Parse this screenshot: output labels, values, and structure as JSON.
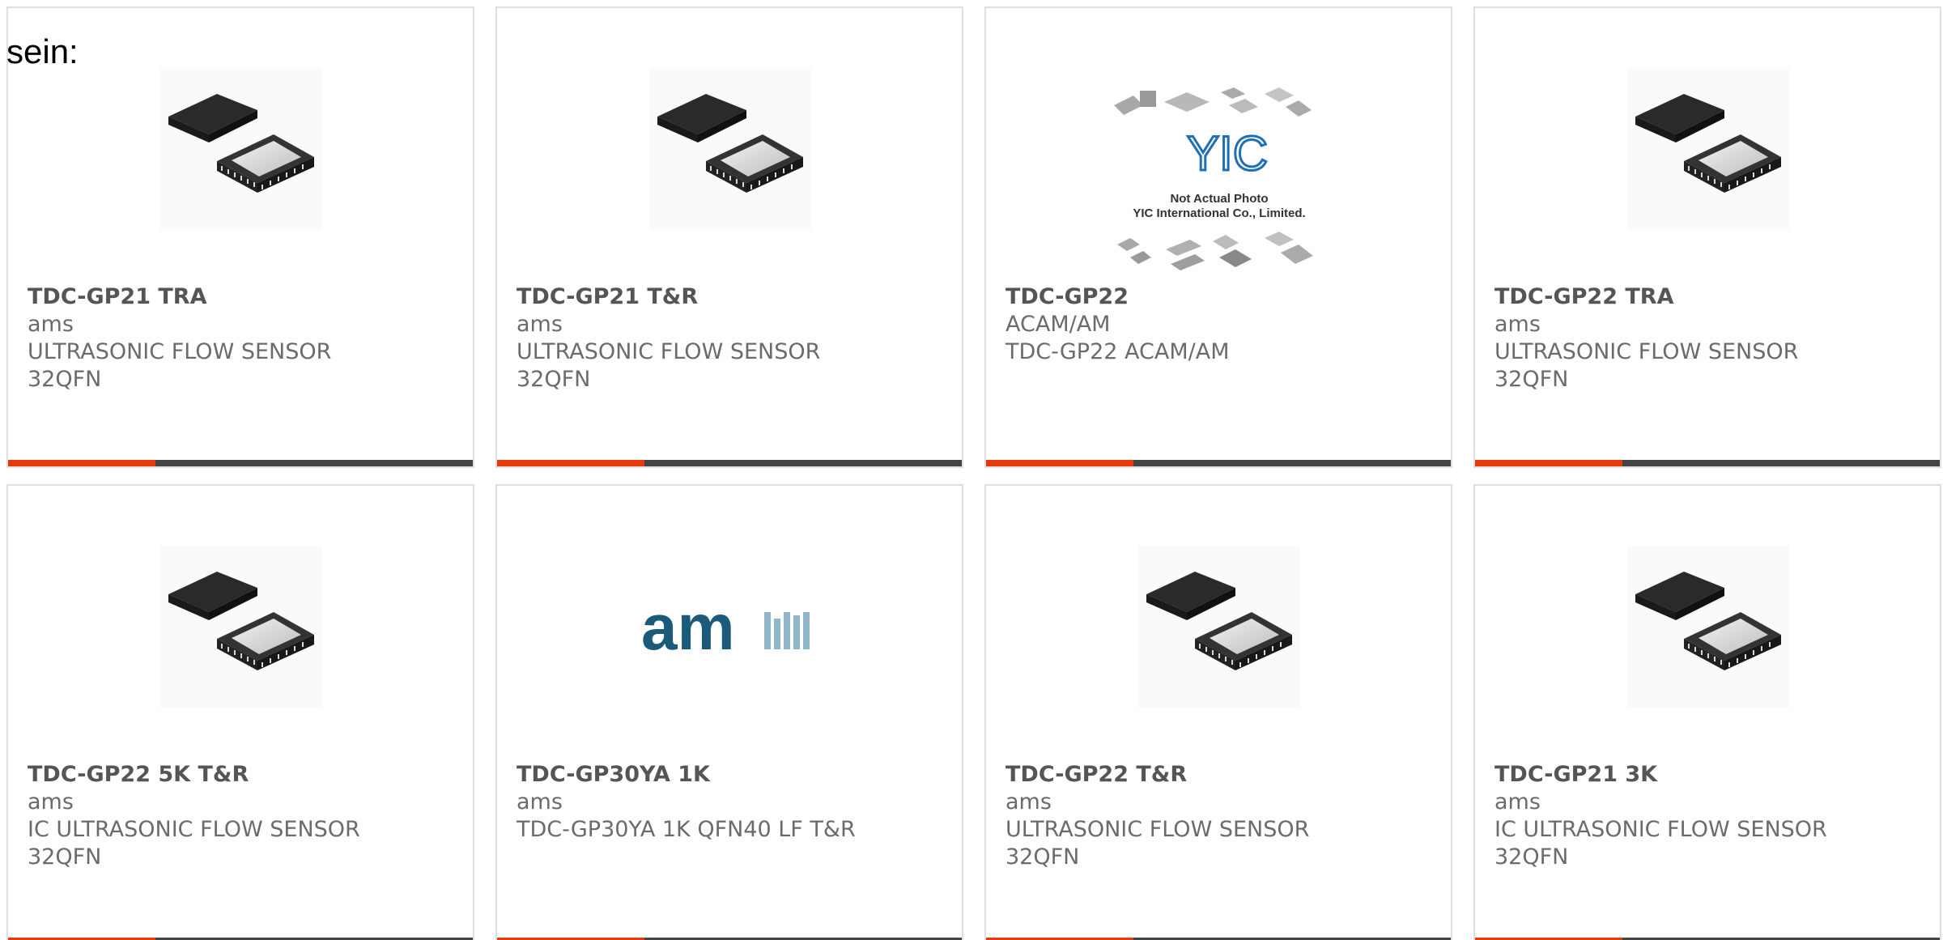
{
  "page": {
    "lead_text": "sein:"
  },
  "colors": {
    "accent": "#e53a0b",
    "bar": "#444444",
    "text": "#6b6b6b",
    "border": "#dedede"
  },
  "products": [
    {
      "part": "TDC-GP21 TRA",
      "manufacturer": "ams",
      "desc1": "ULTRASONIC FLOW SENSOR",
      "desc2": "32QFN",
      "image": "qfn-chip-icon"
    },
    {
      "part": "TDC-GP21 T&R",
      "manufacturer": "ams",
      "desc1": "ULTRASONIC FLOW SENSOR",
      "desc2": "32QFN",
      "image": "qfn-chip-icon"
    },
    {
      "part": "TDC-GP22",
      "manufacturer": "ACAM/AM",
      "desc1": "TDC-GP22 ACAM/AM",
      "desc2": "",
      "image": "yic-placeholder-icon",
      "image_caption_1": "Not Actual Photo",
      "image_caption_2": "YIC International Co., Limited."
    },
    {
      "part": "TDC-GP22 TRA",
      "manufacturer": "ams",
      "desc1": "ULTRASONIC FLOW SENSOR",
      "desc2": "32QFN",
      "image": "qfn-chip-icon"
    },
    {
      "part": "TDC-GP22 5K T&R",
      "manufacturer": "ams",
      "desc1": "IC ULTRASONIC FLOW SENSOR",
      "desc2": "32QFN",
      "image": "qfn-chip-icon"
    },
    {
      "part": "TDC-GP30YA 1K",
      "manufacturer": "ams",
      "desc1": "TDC-GP30YA 1K QFN40 LF T&R",
      "desc2": "",
      "image": "ams-logo-icon",
      "logo_text": "am"
    },
    {
      "part": "TDC-GP22 T&R",
      "manufacturer": "ams",
      "desc1": "ULTRASONIC FLOW SENSOR",
      "desc2": "32QFN",
      "image": "qfn-chip-icon"
    },
    {
      "part": "TDC-GP21 3K",
      "manufacturer": "ams",
      "desc1": "IC ULTRASONIC FLOW SENSOR",
      "desc2": "32QFN",
      "image": "qfn-chip-icon"
    }
  ]
}
